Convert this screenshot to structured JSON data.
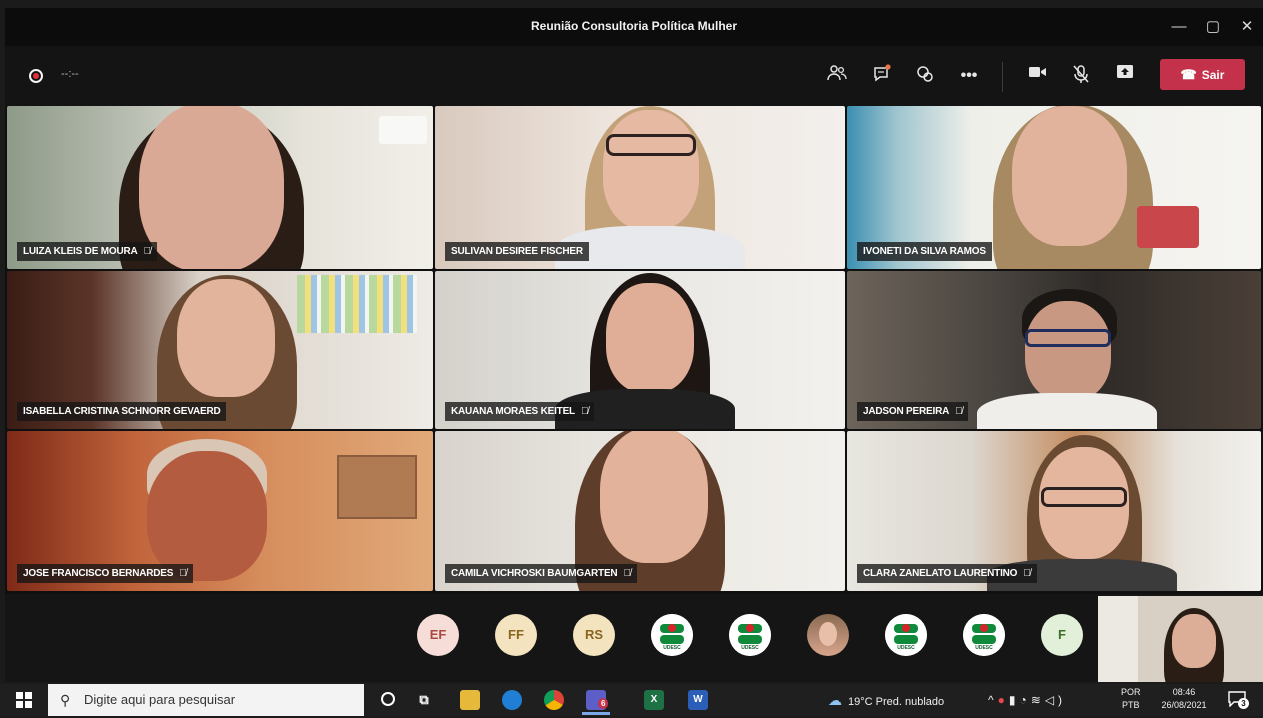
{
  "window": {
    "title": "Reunião Consultoria Política Mulher",
    "controls": [
      "—",
      "▢",
      "✕"
    ]
  },
  "toolbar": {
    "timer": "--:--",
    "leave_label": "Sair",
    "leave_icon": "phone-hangup-icon",
    "accent": "#c4314b"
  },
  "participants": [
    {
      "name": "LUIZA KLEIS DE MOURA",
      "muted": true
    },
    {
      "name": "SULIVAN DESIREE FISCHER",
      "muted": false
    },
    {
      "name": "IVONETI DA SILVA RAMOS",
      "muted": false
    },
    {
      "name": "ISABELLA CRISTINA SCHNORR GEVAERD",
      "muted": false
    },
    {
      "name": "KAUANA MORAES KEITEL",
      "muted": true
    },
    {
      "name": "JADSON PEREIRA",
      "muted": true
    },
    {
      "name": "JOSE FRANCISCO BERNARDES",
      "muted": true
    },
    {
      "name": "CAMILA VICHROSKI BAUMGARTEN",
      "muted": true
    },
    {
      "name": "CLARA ZANELATO LAURENTINO",
      "muted": true
    }
  ],
  "avatars": [
    {
      "initials": "EF"
    },
    {
      "initials": "FF"
    },
    {
      "initials": "RS"
    },
    {
      "initials": "",
      "logo_text": "UDESC"
    },
    {
      "initials": "",
      "logo_text": "UDESC"
    },
    {
      "initials": ""
    },
    {
      "initials": "",
      "logo_text": "UDESC"
    },
    {
      "initials": "",
      "logo_text": "UDESC"
    },
    {
      "initials": "F"
    }
  ],
  "taskbar": {
    "search_placeholder": "Digite aqui para pesquisar",
    "teams_badge": "6",
    "weather": "19°C  Pred. nublado",
    "lang_top": "POR",
    "lang_bottom": "PTB",
    "time": "08:46",
    "date": "26/08/2021",
    "notifications": "3"
  }
}
